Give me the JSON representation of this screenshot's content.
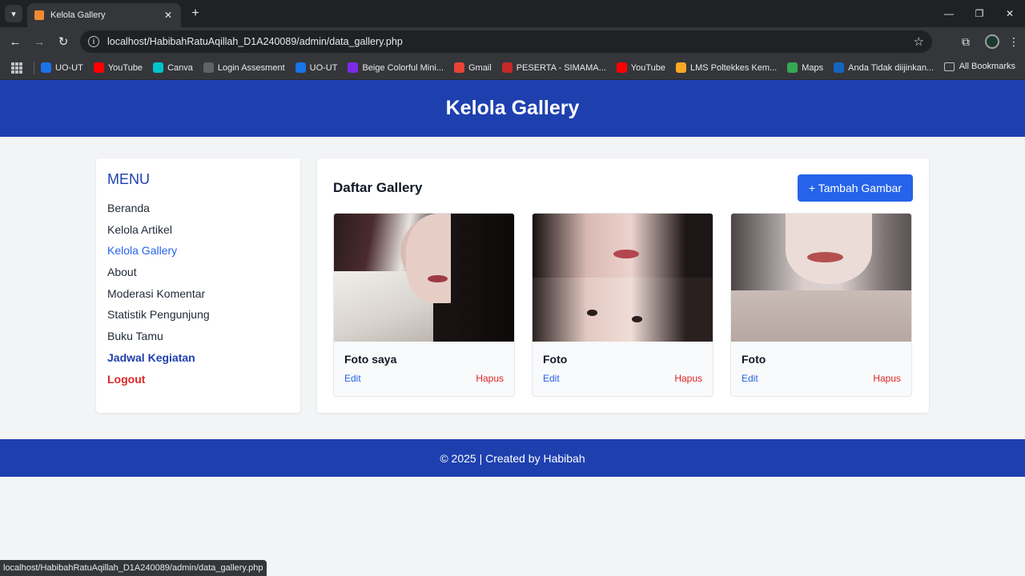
{
  "browser": {
    "tab_title": "Kelola Gallery",
    "url": "localhost/HabibahRatuAqillah_D1A240089/admin/data_gallery.php",
    "status_url": "localhost/HabibahRatuAqillah_D1A240089/admin/data_gallery.php",
    "bookmarks": [
      {
        "label": "UO-UT",
        "icon": "uo-ut-icon",
        "color": "#1a73e8"
      },
      {
        "label": "YouTube",
        "icon": "youtube-icon",
        "color": "#ff0000"
      },
      {
        "label": "Canva",
        "icon": "canva-icon",
        "color": "#00c4cc"
      },
      {
        "label": "Login Assesment",
        "icon": "globe-icon",
        "color": "#5f6368"
      },
      {
        "label": "UO-UT",
        "icon": "uo-ut-icon",
        "color": "#1a73e8"
      },
      {
        "label": "Beige Colorful Mini...",
        "icon": "canva-icon",
        "color": "#7d2ae8"
      },
      {
        "label": "Gmail",
        "icon": "gmail-icon",
        "color": "#ea4335"
      },
      {
        "label": "PESERTA - SIMAMA...",
        "icon": "simama-icon",
        "color": "#c62828"
      },
      {
        "label": "YouTube",
        "icon": "youtube-icon",
        "color": "#ff0000"
      },
      {
        "label": "LMS Poltekkes Kem...",
        "icon": "lms-icon",
        "color": "#f9a825"
      },
      {
        "label": "Maps",
        "icon": "maps-icon",
        "color": "#34a853"
      },
      {
        "label": "Anda Tidak diijinkan...",
        "icon": "globe-icon",
        "color": "#1565c0"
      }
    ],
    "all_bookmarks": "All Bookmarks"
  },
  "header": {
    "title": "Kelola Gallery"
  },
  "sidebar": {
    "title": "MENU",
    "items": [
      {
        "label": "Beranda"
      },
      {
        "label": "Kelola Artikel"
      },
      {
        "label": "Kelola Gallery"
      },
      {
        "label": "About"
      },
      {
        "label": "Moderasi Komentar"
      },
      {
        "label": "Statistik Pengunjung"
      },
      {
        "label": "Buku Tamu"
      },
      {
        "label": "Jadwal Kegiatan"
      },
      {
        "label": "Logout"
      }
    ]
  },
  "main": {
    "heading": "Daftar Gallery",
    "add_button": "+ Tambah Gambar",
    "cards": [
      {
        "title": "Foto saya",
        "edit": "Edit",
        "delete": "Hapus"
      },
      {
        "title": "Foto",
        "edit": "Edit",
        "delete": "Hapus"
      },
      {
        "title": "Foto",
        "edit": "Edit",
        "delete": "Hapus"
      }
    ]
  },
  "footer": {
    "text": "© 2025 | Created by Habibah"
  },
  "colors": {
    "primary": "#1e40af",
    "accent": "#2563eb",
    "danger": "#dc2626"
  }
}
